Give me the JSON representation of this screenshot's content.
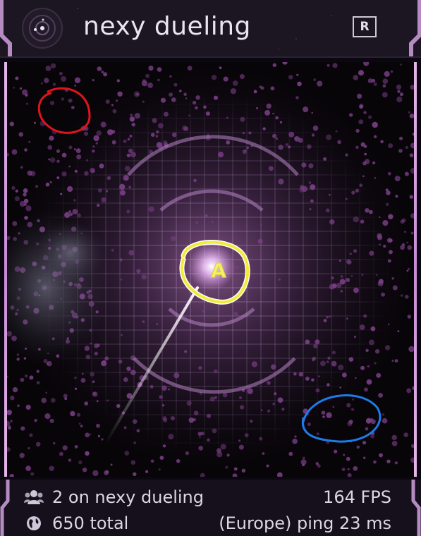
{
  "header": {
    "title": "nexy dueling",
    "ranked_button_label": "R"
  },
  "footer": {
    "players_text": "2 on nexy dueling",
    "fps_text": "164 FPS",
    "total_text": "650 total",
    "region_ping_text": "(Europe) ping 23 ms"
  },
  "arena": {
    "player_label": "A"
  },
  "icons": {
    "logo": "radar-logo-icon",
    "players": "users-icon",
    "globe": "globe-icon"
  },
  "colors": {
    "accent_purple": "#c88ad6",
    "grid": "#c9a4d9",
    "annotation_red": "#e0141c",
    "annotation_blue": "#1f7be8",
    "annotation_yellow": "#f2ea3a"
  }
}
